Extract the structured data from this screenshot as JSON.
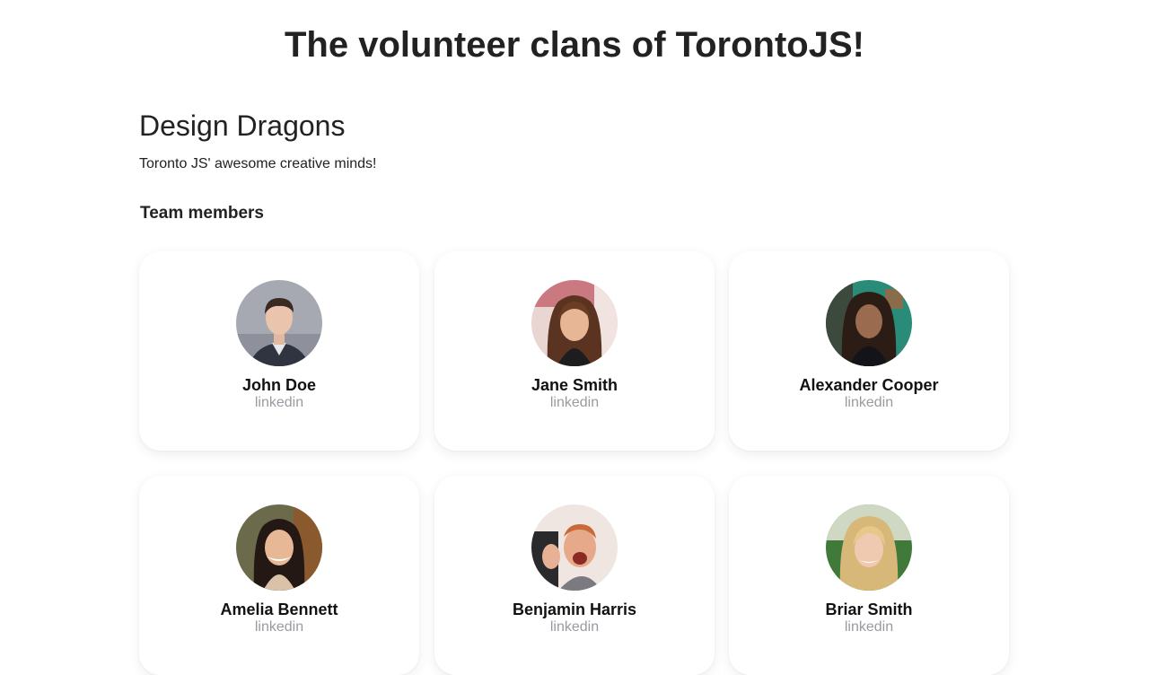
{
  "page": {
    "title": "The volunteer clans of TorontoJS!"
  },
  "clan": {
    "name": "Design Dragons",
    "description": "Toronto JS' awesome creative minds!",
    "team_heading": "Team members"
  },
  "members": [
    {
      "name": "John Doe",
      "link": "linkedin",
      "avatar": "portrait-man-short-hair-suit"
    },
    {
      "name": "Jane Smith",
      "link": "linkedin",
      "avatar": "portrait-woman-long-brown-hair"
    },
    {
      "name": "Alexander Cooper",
      "link": "linkedin",
      "avatar": "portrait-man-dreadlocks"
    },
    {
      "name": "Amelia Bennett",
      "link": "linkedin",
      "avatar": "portrait-woman-smiling-dark-hair"
    },
    {
      "name": "Benjamin Harris",
      "link": "linkedin",
      "avatar": "portrait-man-thumbs-up"
    },
    {
      "name": "Briar Smith",
      "link": "linkedin",
      "avatar": "portrait-woman-blonde-hair"
    }
  ],
  "colors": {
    "text": "#222222",
    "link": "#9a9aa2",
    "card_background": "#ffffff"
  }
}
